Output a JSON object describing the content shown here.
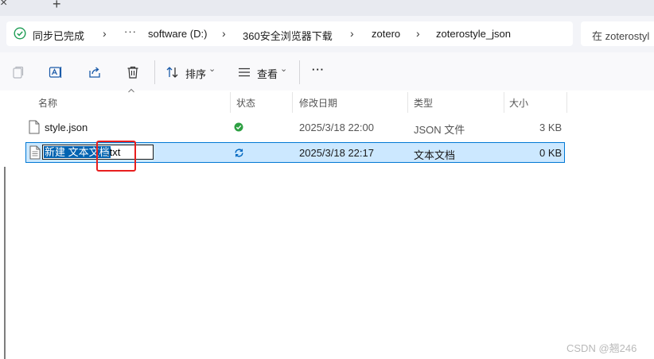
{
  "tabstrip": {
    "close_glyph": "×",
    "new_tab_glyph": "+"
  },
  "address": {
    "sync_status": "同步已完成",
    "more": "···",
    "crumbs": [
      "software (D:)",
      "360安全浏览器下载",
      "zotero",
      "zoterostyle_json"
    ],
    "separator": "›"
  },
  "search": {
    "placeholder": "在 zoterostyl"
  },
  "toolbar": {
    "icons": [
      "copy-icon",
      "rename-icon",
      "share-icon",
      "delete-icon"
    ],
    "sort_label": "排序",
    "view_label": "查看",
    "more": "···",
    "caret": "⌄"
  },
  "columns": {
    "name": "名称",
    "status": "状态",
    "modified": "修改日期",
    "type": "类型",
    "size": "大小"
  },
  "files": [
    {
      "name": "style.json",
      "status": "synced",
      "modified": "2025/3/18 22:00",
      "type": "JSON 文件",
      "size": "3 KB"
    },
    {
      "name": "新建 文本文档.txt",
      "name_selected": "新建 文本文档",
      "name_ext": ".txt",
      "status": "syncing",
      "modified": "2025/3/18 22:17",
      "type": "文本文档",
      "size": "0 KB",
      "selected": true,
      "renaming": true
    }
  ],
  "colors": {
    "selection_bg": "#cce8ff",
    "selection_border": "#0078d4",
    "accent": "#0067c0",
    "synced_green": "#2ea043",
    "highlight_red": "#e81e1e"
  },
  "watermark": "CSDN @翘246"
}
